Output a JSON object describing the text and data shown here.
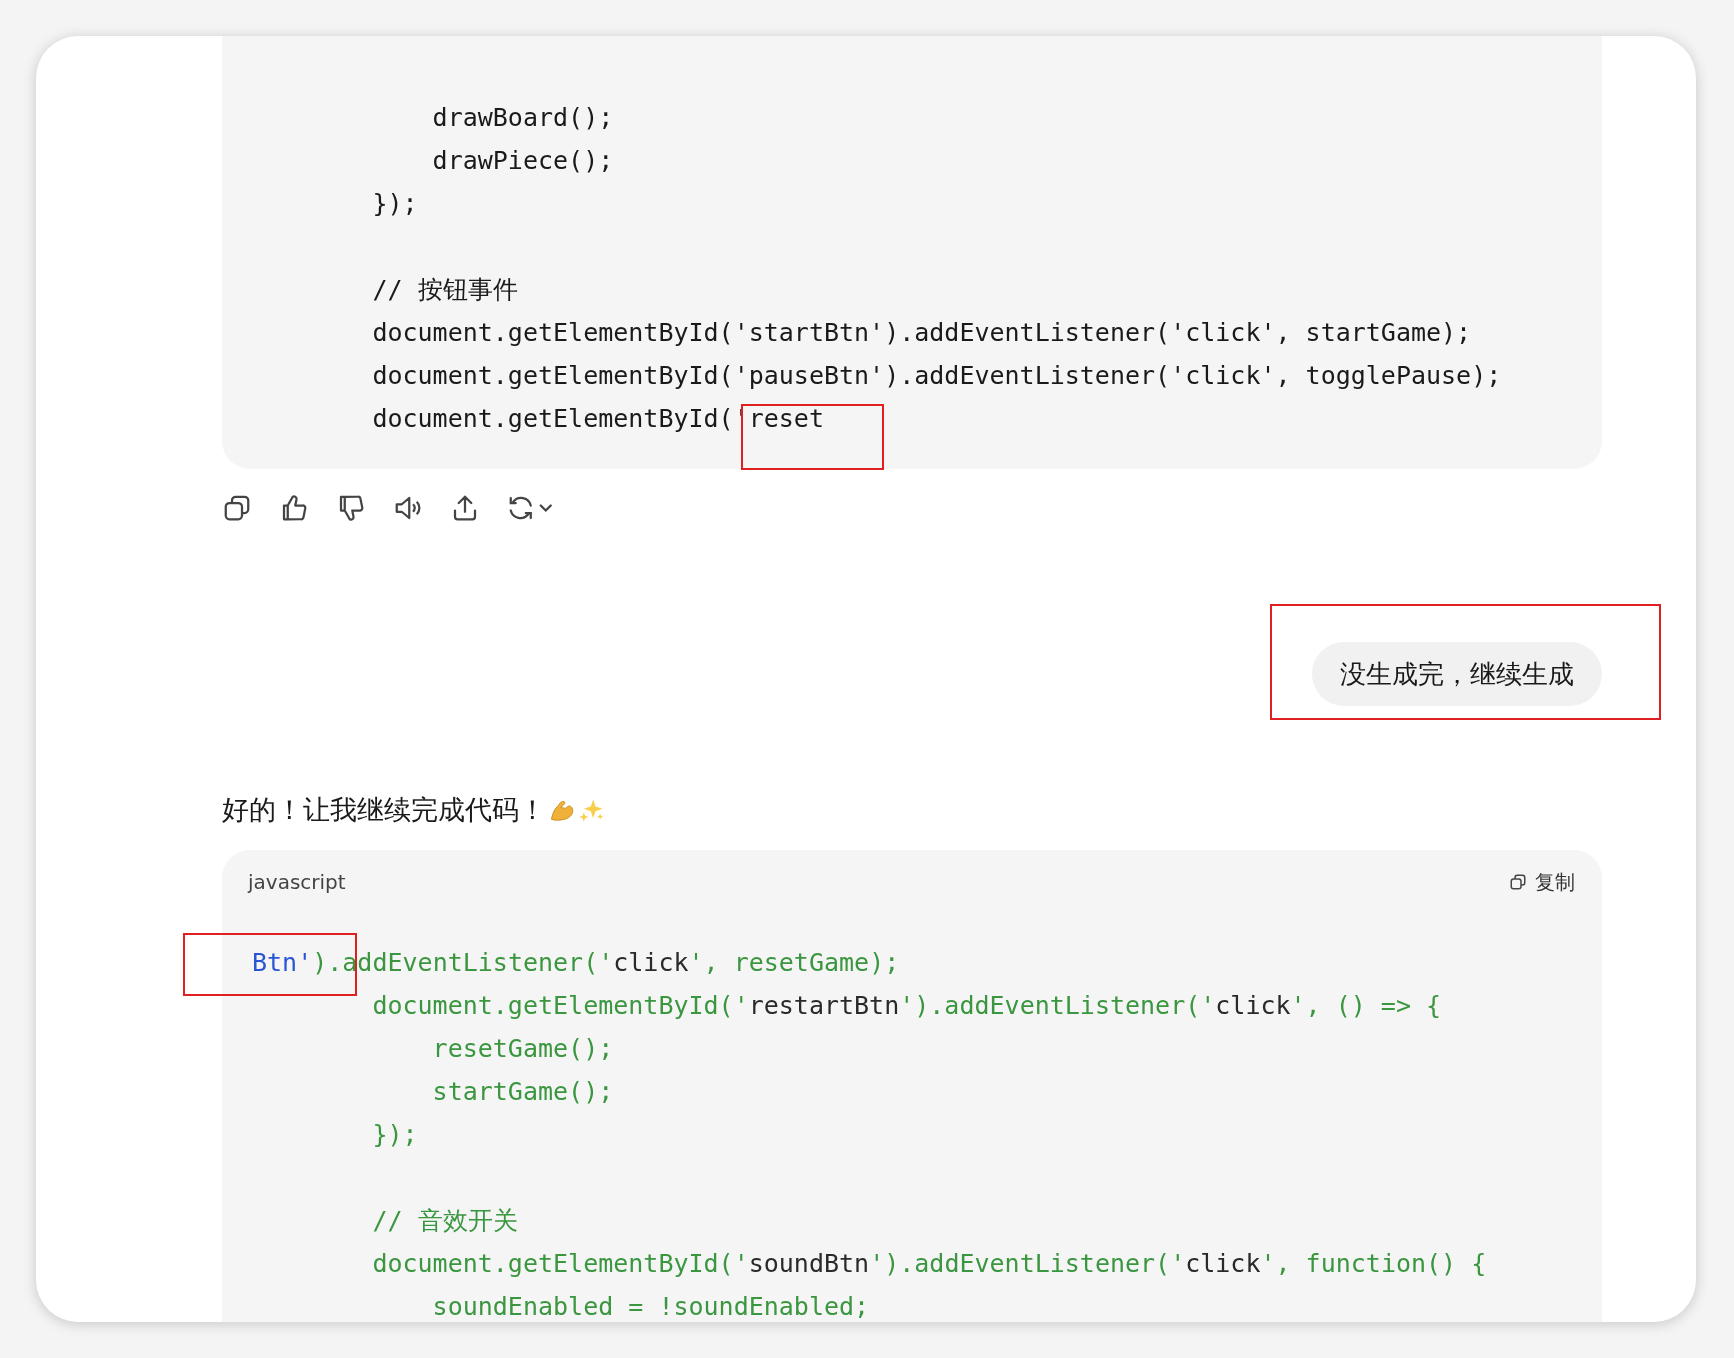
{
  "code_block_1": {
    "lines": [
      {
        "tokens": [
          {
            "kind": "plain",
            "text": "            drawBoard();"
          }
        ]
      },
      {
        "tokens": [
          {
            "kind": "plain",
            "text": "            drawPiece();"
          }
        ]
      },
      {
        "tokens": [
          {
            "kind": "plain",
            "text": "        });"
          }
        ]
      },
      {
        "gap_before": true,
        "tokens": [
          {
            "kind": "plain",
            "text": "        // 按钮事件"
          }
        ]
      },
      {
        "tokens": [
          {
            "kind": "plain",
            "text": "        document.getElementById('startBtn').addEventListener('click', startGame);"
          }
        ]
      },
      {
        "tokens": [
          {
            "kind": "plain",
            "text": "        document.getElementById('pauseBtn').addEventListener('click', togglePause);"
          }
        ]
      },
      {
        "tokens": [
          {
            "kind": "plain",
            "text": "        document.getElementById('"
          },
          {
            "kind": "plain",
            "text": "reset",
            "highlighted": true
          }
        ]
      }
    ]
  },
  "user_message": {
    "text": "没生成完，继续生成",
    "highlighted": true
  },
  "assistant_message": {
    "text": "好的！让我继续完成代码！"
  },
  "code_block_2": {
    "language": "javascript",
    "copy_label": "复制",
    "lines": [
      {
        "tokens": [
          {
            "kind": "name",
            "text": "Btn'",
            "highlighted": true
          },
          {
            "kind": "code",
            "text": ").addEventListener('"
          },
          {
            "kind": "string",
            "text": "click"
          },
          {
            "kind": "code",
            "text": "', resetGame);"
          }
        ]
      },
      {
        "tokens": [
          {
            "kind": "code",
            "text": "        document.getElementById('"
          },
          {
            "kind": "string",
            "text": "restartBtn"
          },
          {
            "kind": "code",
            "text": "').addEventListener('"
          },
          {
            "kind": "string",
            "text": "click"
          },
          {
            "kind": "code",
            "text": "', () => {"
          }
        ]
      },
      {
        "tokens": [
          {
            "kind": "code",
            "text": "            resetGame();"
          }
        ]
      },
      {
        "tokens": [
          {
            "kind": "code",
            "text": "            startGame();"
          }
        ]
      },
      {
        "tokens": [
          {
            "kind": "code",
            "text": "        });"
          }
        ]
      },
      {
        "gap_before": true,
        "tokens": [
          {
            "kind": "code",
            "text": "        // 音效开关"
          }
        ]
      },
      {
        "tokens": [
          {
            "kind": "code",
            "text": "        document.getElementById('"
          },
          {
            "kind": "string",
            "text": "soundBtn"
          },
          {
            "kind": "code",
            "text": "').addEventListener('"
          },
          {
            "kind": "string",
            "text": "click"
          },
          {
            "kind": "code",
            "text": "', function() {"
          }
        ]
      },
      {
        "tokens": [
          {
            "kind": "code",
            "text": "            soundEnabled = !soundEnabled;"
          }
        ]
      }
    ]
  }
}
